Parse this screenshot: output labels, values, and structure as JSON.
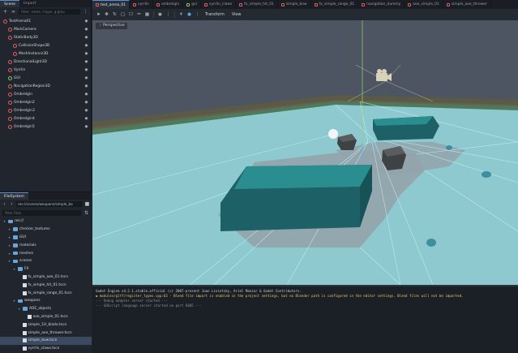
{
  "scene_dock": {
    "tabs": [
      "Scene",
      "Import"
    ],
    "filter_placeholder": "Filter: name, t:type, g:grou",
    "nodes": [
      {
        "label": "TestArena01",
        "color": "#e45d5d"
      },
      {
        "label": "MainCamera",
        "color": "#e45d5d"
      },
      {
        "label": "StaticBody3D",
        "color": "#e45d5d"
      },
      {
        "label": "CollisionShape3D",
        "color": "#e45d5d"
      },
      {
        "label": "MeshInstance3D",
        "color": "#e45d5d"
      },
      {
        "label": "DirectionalLight3D",
        "color": "#e45d5d"
      },
      {
        "label": "Vyrrlin",
        "color": "#e45d5d"
      },
      {
        "label": "GUI",
        "color": "#8fc26a"
      },
      {
        "label": "NavigationRegion3D",
        "color": "#e45d5d"
      },
      {
        "label": "Ombrelgin",
        "color": "#e45d5d"
      },
      {
        "label": "Ombrelgin2",
        "color": "#e45d5d"
      },
      {
        "label": "Ombrelgin3",
        "color": "#e45d5d"
      },
      {
        "label": "Ombrelgin4",
        "color": "#e45d5d"
      },
      {
        "label": "Ombrelgin5",
        "color": "#e45d5d"
      }
    ]
  },
  "filesystem": {
    "title": "FileSystem",
    "path": "res://scenes/weapons/simple_bo",
    "filter_placeholder": "Filter Files",
    "items": [
      {
        "label": "res://",
        "kind": "folder",
        "depth": 0
      },
      {
        "label": "checker_textures",
        "kind": "folder",
        "depth": 1
      },
      {
        "label": "GUI",
        "kind": "folder",
        "depth": 1
      },
      {
        "label": "materials",
        "kind": "folder",
        "depth": 1
      },
      {
        "label": "meshes",
        "kind": "folder",
        "depth": 1
      },
      {
        "label": "scenes",
        "kind": "folder",
        "depth": 1
      },
      {
        "label": "FX",
        "kind": "folder",
        "depth": 2
      },
      {
        "label": "fx_simple_aoe_01.tscn",
        "kind": "file",
        "depth": 3
      },
      {
        "label": "fx_simple_hit_01.tscn",
        "kind": "file",
        "depth": 3
      },
      {
        "label": "fx_simple_range_01.tscn",
        "kind": "file",
        "depth": 3
      },
      {
        "label": "weapons",
        "kind": "folder",
        "depth": 2
      },
      {
        "label": "AOE_objects",
        "kind": "folder",
        "depth": 3
      },
      {
        "label": "aoe_simple_01.tscn",
        "kind": "file",
        "depth": 4
      },
      {
        "label": "simple_1H_blade.tscn",
        "kind": "file",
        "depth": 3
      },
      {
        "label": "simple_aoe_thrower.tscn",
        "kind": "file",
        "depth": 3
      },
      {
        "label": "simple_bow.tscn",
        "kind": "file",
        "depth": 3,
        "selected": true
      },
      {
        "label": "vyrrlin_claws.tscn",
        "kind": "file",
        "depth": 3
      }
    ]
  },
  "scene_tabs": [
    {
      "label": "test_arena_01",
      "active": true,
      "color": "#e45d5d"
    },
    {
      "label": "vyrrlin",
      "color": "#e45d5d"
    },
    {
      "label": "ombrelgin",
      "color": "#e45d5d"
    },
    {
      "label": "gui",
      "color": "#8fc26a"
    },
    {
      "label": "vyrrlin_claws",
      "color": "#e45d5d"
    },
    {
      "label": "fx_simple_hit_01",
      "color": "#e45d5d"
    },
    {
      "label": "simple_bow",
      "color": "#e45d5d"
    },
    {
      "label": "fx_simple_range_01",
      "color": "#e45d5d"
    },
    {
      "label": "navigation_dummy",
      "color": "#e45d5d"
    },
    {
      "label": "aoe_simple_01",
      "color": "#e45d5d"
    },
    {
      "label": "simple_aoe_thrower",
      "color": "#e45d5d"
    }
  ],
  "viewport_toolbar": {
    "menus": [
      "Transform",
      "View"
    ]
  },
  "viewport": {
    "perspective_label": "Perspective"
  },
  "output": {
    "lines": [
      {
        "text": "Godot Engine v4.2.1.stable.official (c) 2007-present Juan Linietsky, Ariel Manzur & Godot Contributors.",
        "kind": "normal"
      },
      {
        "text": "◆ modules/gltf/register_types.cpp:63 - Blend file import is enabled in the project settings, but no Blender path is configured in the editor settings. Blend files will not be imported.",
        "kind": "warn"
      },
      {
        "text": "--- Debug adapter server started ---",
        "kind": "dim"
      },
      {
        "text": "--- GDScript language server started on port 6005 ---",
        "kind": "dim"
      }
    ]
  }
}
